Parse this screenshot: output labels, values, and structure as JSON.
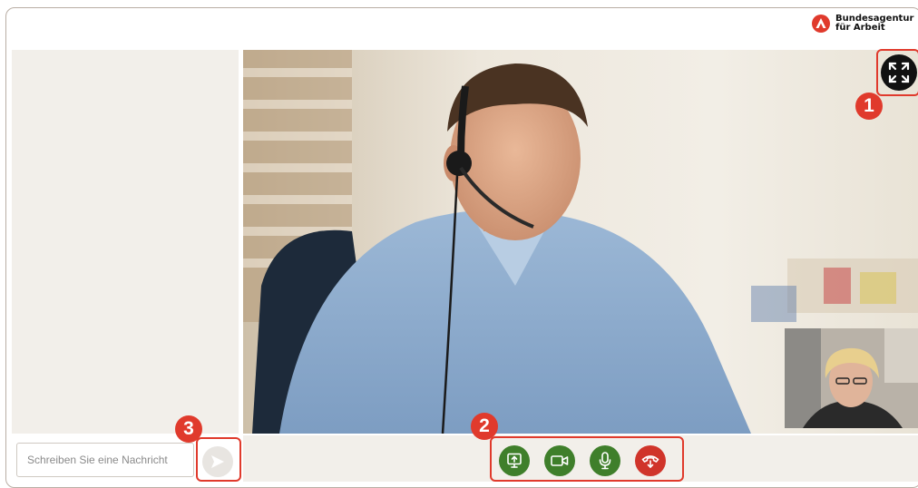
{
  "brand": {
    "name_line1": "Bundesagentur",
    "name_line2": "für Arbeit",
    "color": "#e03a2c"
  },
  "chat": {
    "input_placeholder": "Schreiben Sie eine Nachricht",
    "send_icon": "send-arrow-icon"
  },
  "video": {
    "main_participant": "agent-with-headset",
    "self_view": "self-view-thumbnail",
    "fullscreen_icon": "fullscreen-expand-icon"
  },
  "controls": [
    {
      "name": "share-screen-button",
      "icon": "screen-share-icon",
      "color": "#3f7f2b"
    },
    {
      "name": "camera-button",
      "icon": "camera-icon",
      "color": "#3f7f2b"
    },
    {
      "name": "microphone-button",
      "icon": "microphone-icon",
      "color": "#3f7f2b"
    },
    {
      "name": "hang-up-button",
      "icon": "hang-up-icon",
      "color": "#d0342a"
    }
  ],
  "callouts": {
    "one": "1",
    "two": "2",
    "three": "3",
    "color": "#e03a2c"
  }
}
